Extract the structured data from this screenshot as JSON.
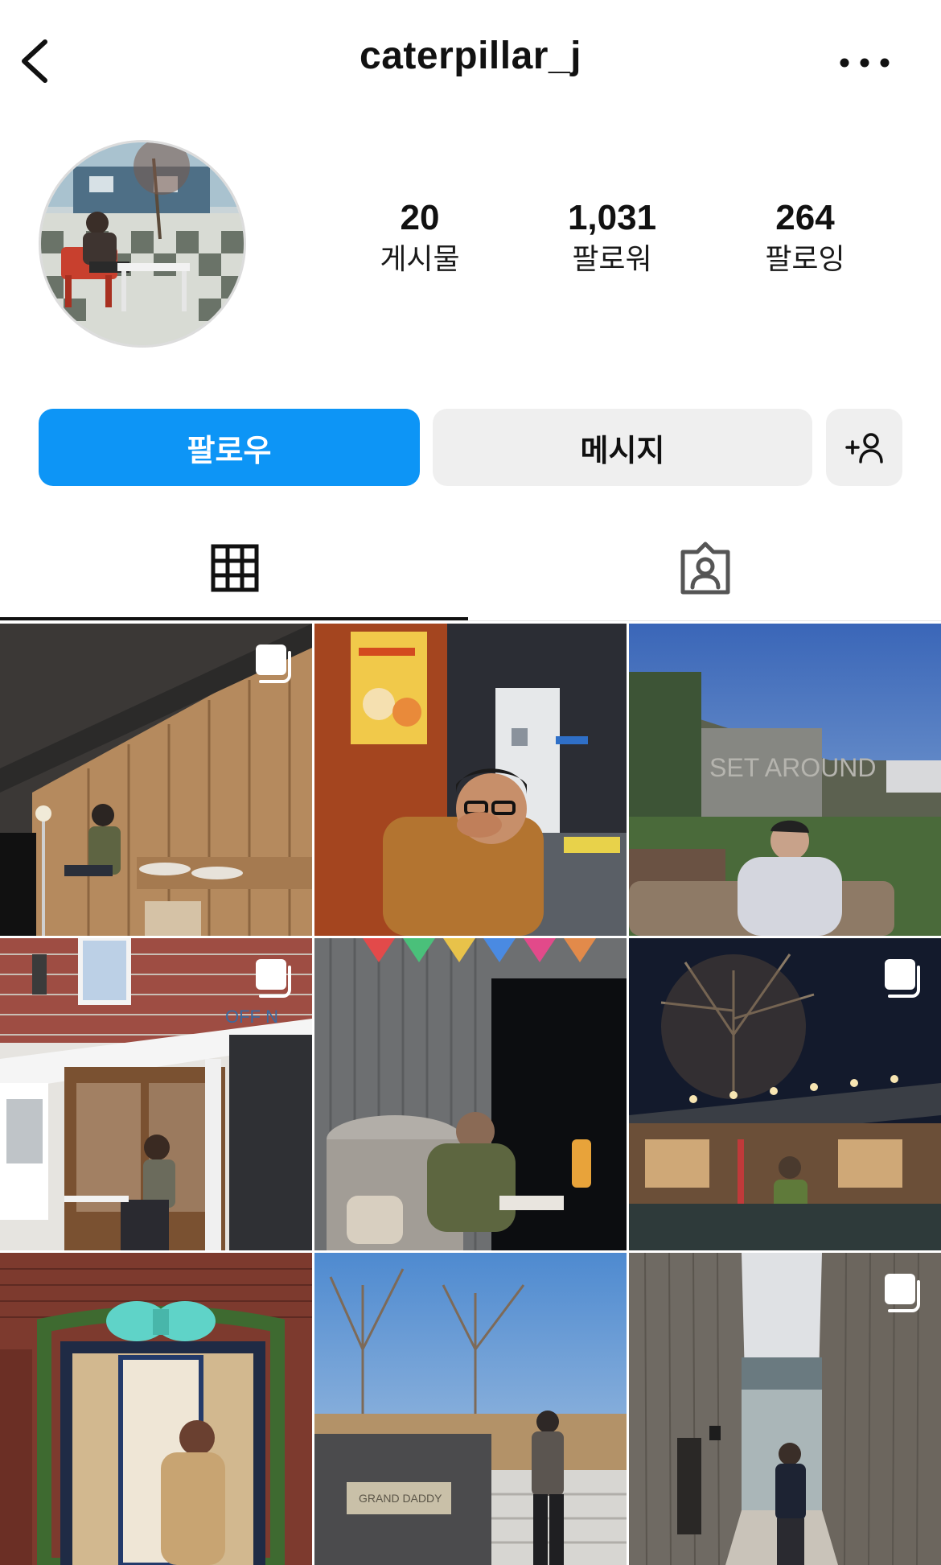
{
  "header": {
    "username": "caterpillar_j",
    "back_icon": "chevron-left-icon",
    "more_icon": "more-horizontal-icon"
  },
  "stats": [
    {
      "value": "20",
      "label": "게시물"
    },
    {
      "value": "1,031",
      "label": "팔로워"
    },
    {
      "value": "264",
      "label": "팔로잉"
    }
  ],
  "actions": {
    "follow_label": "팔로우",
    "message_label": "메시지",
    "add_icon": "add-person-icon"
  },
  "tabs": [
    {
      "name": "posts",
      "icon": "grid-icon",
      "active": true
    },
    {
      "name": "tagged",
      "icon": "tagged-person-icon",
      "active": false
    }
  ],
  "posts": [
    {
      "desc": "cafe wood interior",
      "multi": true
    },
    {
      "desc": "night street close-up",
      "multi": false
    },
    {
      "desc": "outdoor lawn sunset",
      "multi": false
    },
    {
      "desc": "storefront OFF N",
      "multi": true
    },
    {
      "desc": "tent at night with lantern",
      "multi": false
    },
    {
      "desc": "hanok courtyard night",
      "multi": true
    },
    {
      "desc": "brick wall with bow wreath",
      "multi": false
    },
    {
      "desc": "garden grand daddy",
      "multi": false
    },
    {
      "desc": "wooden alley lake view",
      "multi": true
    }
  ],
  "colors": {
    "accent": "#0d95f6",
    "secondary_button": "#efefef"
  }
}
